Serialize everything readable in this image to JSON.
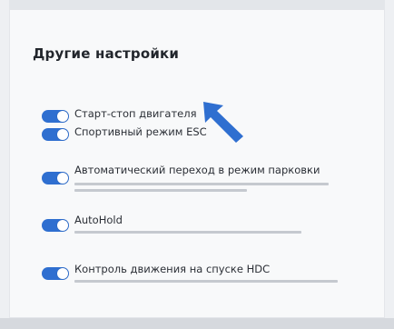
{
  "section": {
    "title": "Другие настройки"
  },
  "settings": [
    {
      "label": "Старт-стоп двигателя",
      "enabled": true
    },
    {
      "label": "Спортивный режим ESC",
      "enabled": true
    },
    {
      "label": "Автоматический переход в режим парковки",
      "enabled": true
    },
    {
      "label": "AutoHold",
      "enabled": true
    },
    {
      "label": "Контроль движения на спуске HDC",
      "enabled": true
    }
  ],
  "colors": {
    "accent": "#2f6fd0",
    "pointer": "#2f6fd0"
  },
  "icons": [
    "toggle-switch",
    "pointer-arrow-icon"
  ]
}
